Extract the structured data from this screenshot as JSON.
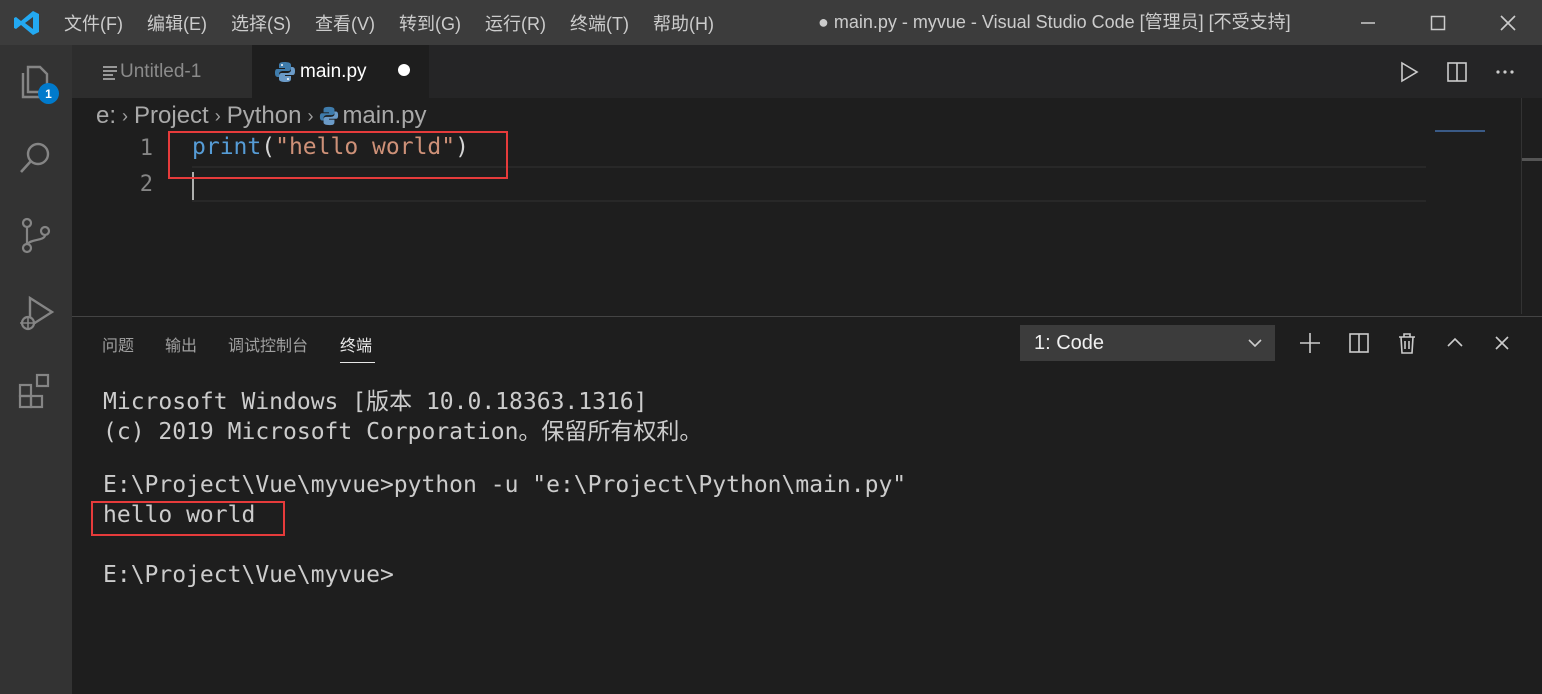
{
  "titlebar": {
    "menu": [
      "文件(F)",
      "编辑(E)",
      "选择(S)",
      "查看(V)",
      "转到(G)",
      "运行(R)",
      "终端(T)",
      "帮助(H)"
    ],
    "window_title": "● main.py - myvue - Visual Studio Code [管理员] [不受支持]"
  },
  "activity_bar": {
    "explorer_badge": "1"
  },
  "tabs": [
    {
      "label": "Untitled-1",
      "icon": "file-lines-icon"
    },
    {
      "label": "main.py",
      "icon": "python-icon",
      "dirty": true
    }
  ],
  "breadcrumb": [
    "e:",
    "Project",
    "Python",
    "main.py"
  ],
  "editor": {
    "line_numbers": [
      "1",
      "2"
    ],
    "code_line_1": {
      "fn": "print",
      "open": "(",
      "str": "\"hello world\"",
      "close": ")"
    }
  },
  "panel": {
    "tabs": [
      "问题",
      "输出",
      "调试控制台",
      "终端"
    ],
    "active_tab": "终端",
    "terminal_select": "1: Code"
  },
  "terminal": {
    "lines": [
      "Microsoft Windows [版本 10.0.18363.1316]",
      "(c) 2019 Microsoft Corporation。保留所有权利。",
      "",
      "E:\\Project\\Vue\\myvue>python -u \"e:\\Project\\Python\\main.py\"",
      "hello world",
      "",
      "E:\\Project\\Vue\\myvue>"
    ]
  },
  "colors": {
    "accent": "#007acc",
    "highlight_box": "#e63b3b",
    "keyword": "#569cd6",
    "string": "#ce9178"
  }
}
